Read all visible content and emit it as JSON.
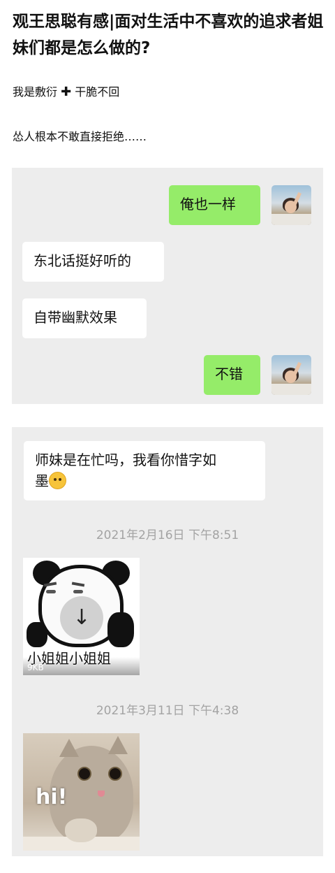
{
  "article": {
    "title": "观王思聪有感|面对生活中不喜欢的追求者姐妹们都是怎么做的?",
    "para1_a": "我是敷衍",
    "para1_plus": "✚",
    "para1_b": "干脆不回",
    "para2": "怂人根本不敢直接拒绝……"
  },
  "chat1": {
    "messages": [
      {
        "side": "right",
        "text": "俺也一样"
      },
      {
        "side": "left",
        "text": "东北话挺好听的"
      },
      {
        "side": "left",
        "text": "自带幽默效果"
      },
      {
        "side": "right",
        "text": "不错"
      }
    ]
  },
  "chat2": {
    "message1_line1": "师妹是在忙吗，我看你惜字如",
    "message1_line2": "墨",
    "emoji": "crying-face-emoji",
    "timestamp1": "2021年2月16日 下午8:51",
    "sticker1": {
      "caption": "小姐姐小姐姐",
      "size": "9KB",
      "download_icon": "↓"
    },
    "timestamp2": "2021年3月11日 下午4:38",
    "sticker2": {
      "caption": "hi!"
    }
  },
  "colors": {
    "panel_bg": "#ededed",
    "bubble_left": "#ffffff",
    "bubble_right": "#95ec69",
    "timestamp": "#a3a3a3"
  }
}
